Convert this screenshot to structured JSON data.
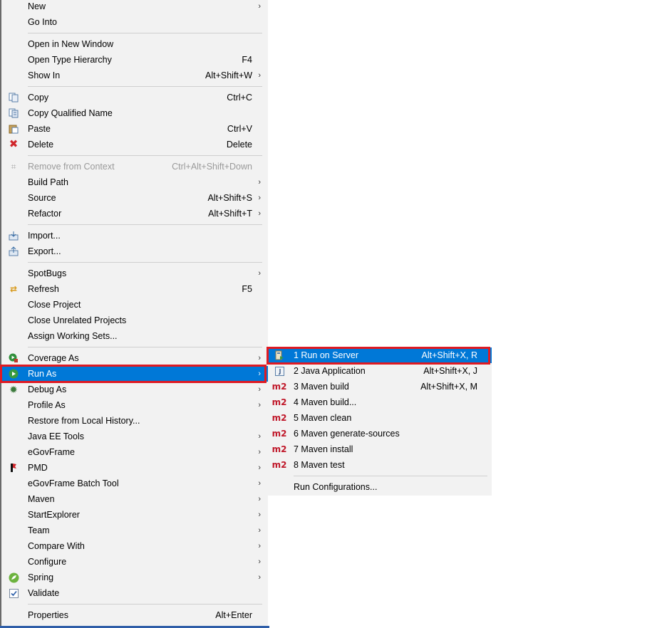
{
  "main_menu": {
    "new": {
      "label": "New",
      "arrow": "›"
    },
    "go_into": {
      "label": "Go Into"
    },
    "open_new_window": {
      "label": "Open in New Window"
    },
    "open_type_hierarchy": {
      "label": "Open Type Hierarchy",
      "shortcut": "F4"
    },
    "show_in": {
      "label": "Show In",
      "shortcut": "Alt+Shift+W",
      "arrow": "›"
    },
    "copy": {
      "label": "Copy",
      "shortcut": "Ctrl+C"
    },
    "copy_qualified_name": {
      "label": "Copy Qualified Name"
    },
    "paste": {
      "label": "Paste",
      "shortcut": "Ctrl+V"
    },
    "delete": {
      "label": "Delete",
      "shortcut": "Delete"
    },
    "remove_from_context": {
      "label": "Remove from Context",
      "shortcut": "Ctrl+Alt+Shift+Down"
    },
    "build_path": {
      "label": "Build Path",
      "arrow": "›"
    },
    "source": {
      "label": "Source",
      "shortcut": "Alt+Shift+S",
      "arrow": "›"
    },
    "refactor": {
      "label": "Refactor",
      "shortcut": "Alt+Shift+T",
      "arrow": "›"
    },
    "import": {
      "label": "Import..."
    },
    "export": {
      "label": "Export..."
    },
    "spotbugs": {
      "label": "SpotBugs",
      "arrow": "›"
    },
    "refresh": {
      "label": "Refresh",
      "shortcut": "F5"
    },
    "close_project": {
      "label": "Close Project"
    },
    "close_unrelated": {
      "label": "Close Unrelated Projects"
    },
    "assign_working_sets": {
      "label": "Assign Working Sets..."
    },
    "coverage_as": {
      "label": "Coverage As",
      "arrow": "›"
    },
    "run_as": {
      "label": "Run As",
      "arrow": "›"
    },
    "debug_as": {
      "label": "Debug As",
      "arrow": "›"
    },
    "profile_as": {
      "label": "Profile As",
      "arrow": "›"
    },
    "restore_history": {
      "label": "Restore from Local History..."
    },
    "java_ee_tools": {
      "label": "Java EE Tools",
      "arrow": "›"
    },
    "egovframe": {
      "label": "eGovFrame",
      "arrow": "›"
    },
    "pmd": {
      "label": "PMD",
      "arrow": "›"
    },
    "egovframe_batch": {
      "label": "eGovFrame Batch Tool",
      "arrow": "›"
    },
    "maven": {
      "label": "Maven",
      "arrow": "›"
    },
    "startexplorer": {
      "label": "StartExplorer",
      "arrow": "›"
    },
    "team": {
      "label": "Team",
      "arrow": "›"
    },
    "compare_with": {
      "label": "Compare With",
      "arrow": "›"
    },
    "configure": {
      "label": "Configure",
      "arrow": "›"
    },
    "spring": {
      "label": "Spring",
      "arrow": "›"
    },
    "validate": {
      "label": "Validate"
    },
    "properties": {
      "label": "Properties",
      "shortcut": "Alt+Enter"
    }
  },
  "run_as_submenu": {
    "run_on_server": {
      "label": "1 Run on Server",
      "shortcut": "Alt+Shift+X, R"
    },
    "java_application": {
      "label": "2 Java Application",
      "shortcut": "Alt+Shift+X, J"
    },
    "maven_build": {
      "label": "3 Maven build",
      "shortcut": "Alt+Shift+X, M",
      "icon_text": "m2"
    },
    "maven_build_dots": {
      "label": "4 Maven build...",
      "icon_text": "m2"
    },
    "maven_clean": {
      "label": "5 Maven clean",
      "icon_text": "m2"
    },
    "maven_generate_sources": {
      "label": "6 Maven generate-sources",
      "icon_text": "m2"
    },
    "maven_install": {
      "label": "7 Maven install",
      "icon_text": "m2"
    },
    "maven_test": {
      "label": "8 Maven test",
      "icon_text": "m2"
    },
    "run_configurations": {
      "label": "Run Configurations..."
    }
  },
  "colors": {
    "selection": "#0078d7",
    "highlight_box": "#e01a22",
    "menu_bg": "#f2f2f2"
  },
  "icons": [
    "copy-icon",
    "copy-qualified-icon",
    "paste-icon",
    "delete-icon",
    "remove-context-icon",
    "import-icon",
    "export-icon",
    "refresh-icon",
    "coverage-icon",
    "run-icon",
    "debug-icon",
    "pmd-icon",
    "spring-icon",
    "validate-icon",
    "server-icon",
    "java-app-icon",
    "maven-icon"
  ]
}
